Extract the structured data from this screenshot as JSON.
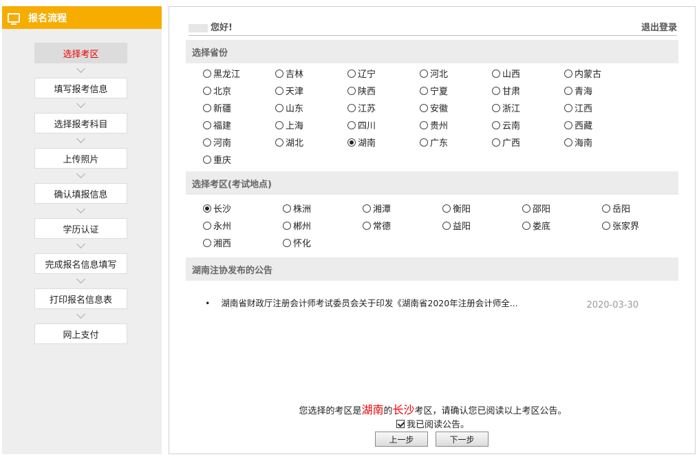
{
  "sidebar": {
    "title": "报名流程",
    "icon": "monitor-icon",
    "steps": [
      "选择考区",
      "填写报考信息",
      "选择报考科目",
      "上传照片",
      "确认填报信息",
      "学历认证",
      "完成报名信息填写",
      "打印报名信息表",
      "网上支付"
    ],
    "active_step": "选择考区"
  },
  "header": {
    "greeting": "您好!",
    "logout": "退出登录"
  },
  "province_section": {
    "title": "选择省份",
    "options": [
      "黑龙江",
      "吉林",
      "辽宁",
      "河北",
      "山西",
      "内蒙古",
      "北京",
      "天津",
      "陕西",
      "宁夏",
      "甘肃",
      "青海",
      "新疆",
      "山东",
      "江苏",
      "安徽",
      "浙江",
      "江西",
      "福建",
      "上海",
      "四川",
      "贵州",
      "云南",
      "西藏",
      "河南",
      "湖北",
      "湖南",
      "广东",
      "广西",
      "海南",
      "重庆"
    ],
    "selected": "湖南"
  },
  "area_section": {
    "title": "选择考区(考试地点)",
    "options": [
      "长沙",
      "株洲",
      "湘潭",
      "衡阳",
      "邵阳",
      "岳阳",
      "永州",
      "郴州",
      "常德",
      "益阳",
      "娄底",
      "张家界",
      "湘西",
      "怀化"
    ],
    "selected": "长沙"
  },
  "notice_section": {
    "title": "湖南注协发布的公告",
    "items": [
      {
        "text": "湖南省财政厅注册会计师考试委员会关于印发《湖南省2020年注册会计师全...",
        "date": "2020-03-30"
      }
    ]
  },
  "confirm": {
    "prefix": "您选择的考区是",
    "province": "湖南",
    "middle": "的",
    "city": "长沙",
    "suffix": "考区，请确认您已阅读以上考区公告。",
    "read_label": "我已阅读公告。"
  },
  "buttons": {
    "prev": "上一步",
    "next": "下一步"
  },
  "colors": {
    "header_orange": "#f6ad00",
    "highlight_red": "#ee0000"
  }
}
